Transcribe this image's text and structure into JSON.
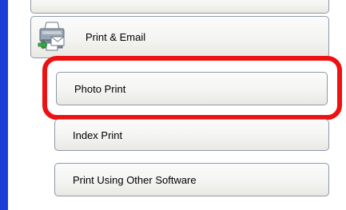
{
  "menu": {
    "section_label": "Print & Email",
    "section_icon": "printer-icon",
    "items": [
      {
        "label": "Photo Print",
        "highlighted": true
      },
      {
        "label": "Index Print"
      },
      {
        "label": "Print Using Other Software"
      }
    ]
  },
  "colors": {
    "left_strip": "#1b3fd6",
    "highlight": "#ee1111",
    "button_border": "#8d98a8"
  }
}
